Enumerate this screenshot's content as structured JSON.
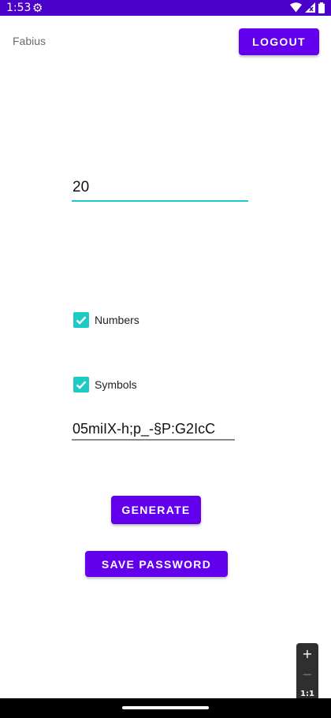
{
  "status_bar": {
    "time": "1:53",
    "gear_glyph": "⚙",
    "icons": [
      "settings-icon",
      "wifi-icon",
      "no-signal-icon",
      "battery-icon"
    ],
    "background": "#4a00c8"
  },
  "header": {
    "username": "Fabius",
    "logout_label": "LOGOUT"
  },
  "form": {
    "length_value": "20",
    "numbers_label": "Numbers",
    "numbers_checked": true,
    "symbols_label": "Symbols",
    "symbols_checked": true,
    "password_value": "05miIX-h;p_-§P:G2IcC"
  },
  "actions": {
    "generate_label": "GENERATE",
    "save_label": "SAVE PASSWORD"
  },
  "zoom_controls": {
    "plus": "+",
    "minus": "−",
    "ratio": "1:1"
  },
  "colors": {
    "primary": "#6200ee",
    "accent": "#1ecbc4"
  }
}
